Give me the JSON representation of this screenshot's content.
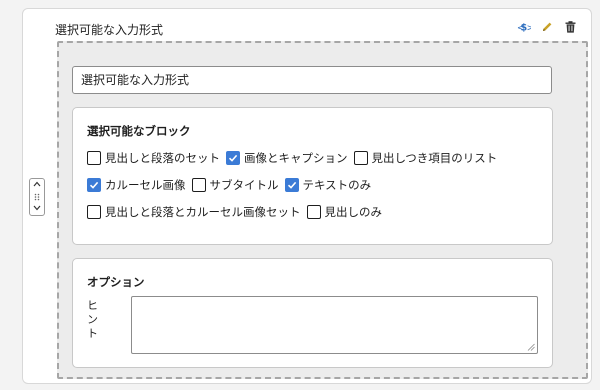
{
  "block": {
    "title": "選択可能な入力形式",
    "tools": [
      "dollar-brace-icon",
      "pencil-icon",
      "trash-icon"
    ]
  },
  "input": {
    "value": "選択可能な入力形式"
  },
  "blocks_panel": {
    "heading": "選択可能なブロック",
    "options": [
      {
        "label": "見出しと段落のセット",
        "checked": false
      },
      {
        "label": "画像とキャプション",
        "checked": true
      },
      {
        "label": "見出しつき項目のリスト",
        "checked": false
      },
      {
        "label": "カルーセル画像",
        "checked": true
      },
      {
        "label": "サブタイトル",
        "checked": false
      },
      {
        "label": "テキストのみ",
        "checked": true
      },
      {
        "label": "見出しと段落とカルーセル画像セット",
        "checked": false
      },
      {
        "label": "見出しのみ",
        "checked": false
      }
    ]
  },
  "options_panel": {
    "heading": "オプション",
    "hint_label": "ヒント",
    "hint_value": ""
  },
  "colors": {
    "accent": "#3b7bd6",
    "dashed_border": "#a6a6a6"
  }
}
